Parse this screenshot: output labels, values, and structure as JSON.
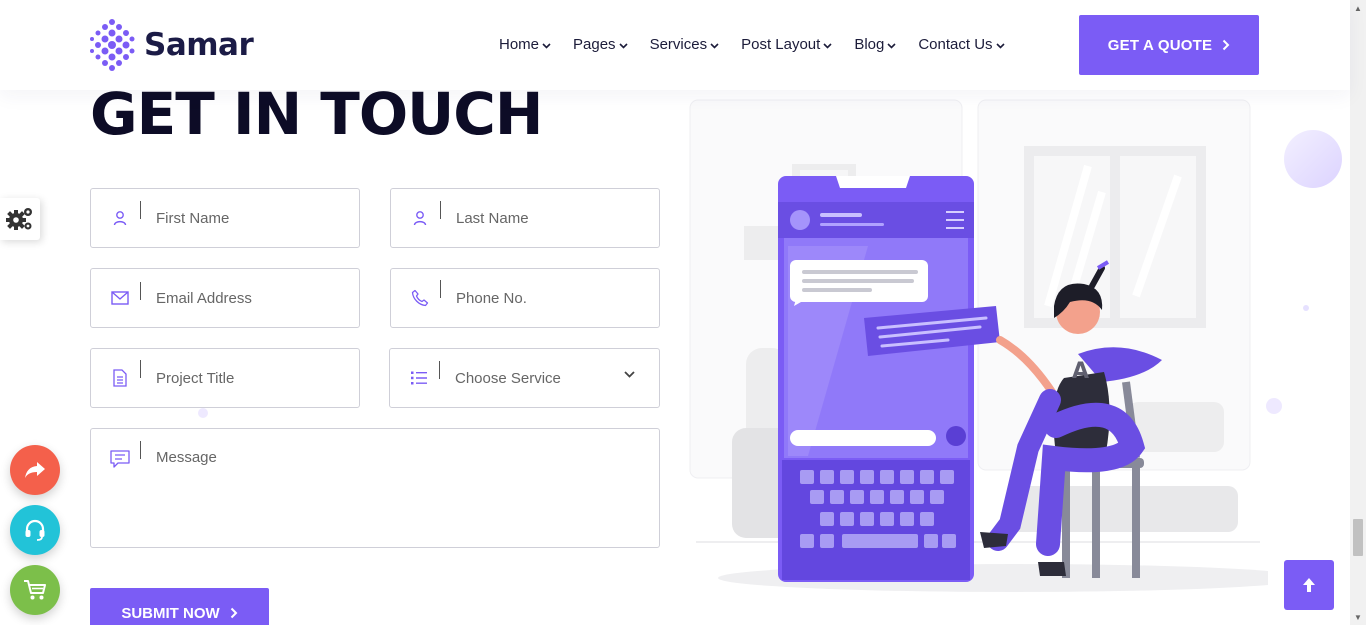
{
  "header": {
    "logo_text": "Samar",
    "nav": [
      {
        "label": "Home"
      },
      {
        "label": "Pages"
      },
      {
        "label": "Services"
      },
      {
        "label": "Post Layout"
      },
      {
        "label": "Blog"
      },
      {
        "label": "Contact Us"
      }
    ],
    "quote_button": "GET A QUOTE",
    "icons": {
      "chevron": "chevron-down-icon",
      "arrow": "chevron-right-icon"
    }
  },
  "main": {
    "title": "GET IN TOUCH",
    "form": {
      "first_name": {
        "placeholder": "First Name",
        "icon": "user-icon"
      },
      "last_name": {
        "placeholder": "Last Name",
        "icon": "user-icon"
      },
      "email": {
        "placeholder": "Email Address",
        "icon": "envelope-icon"
      },
      "phone": {
        "placeholder": "Phone No.",
        "icon": "phone-icon"
      },
      "project_title": {
        "placeholder": "Project Title",
        "icon": "document-icon"
      },
      "service": {
        "selected": "Choose Service",
        "icon": "list-icon"
      },
      "message": {
        "placeholder": "Message",
        "icon": "chat-icon"
      },
      "submit_label": "SUBMIT NOW"
    }
  },
  "widgets": {
    "settings_icon": "gears-icon",
    "share_icon": "share-icon",
    "support_icon": "headset-icon",
    "cart_icon": "cart-icon",
    "to_top_icon": "arrow-up-icon"
  },
  "colors": {
    "accent": "#7b5cf5",
    "title": "#0d0c26",
    "share": "#f4604b",
    "support": "#22c3d8",
    "cart": "#7cbf4a"
  }
}
